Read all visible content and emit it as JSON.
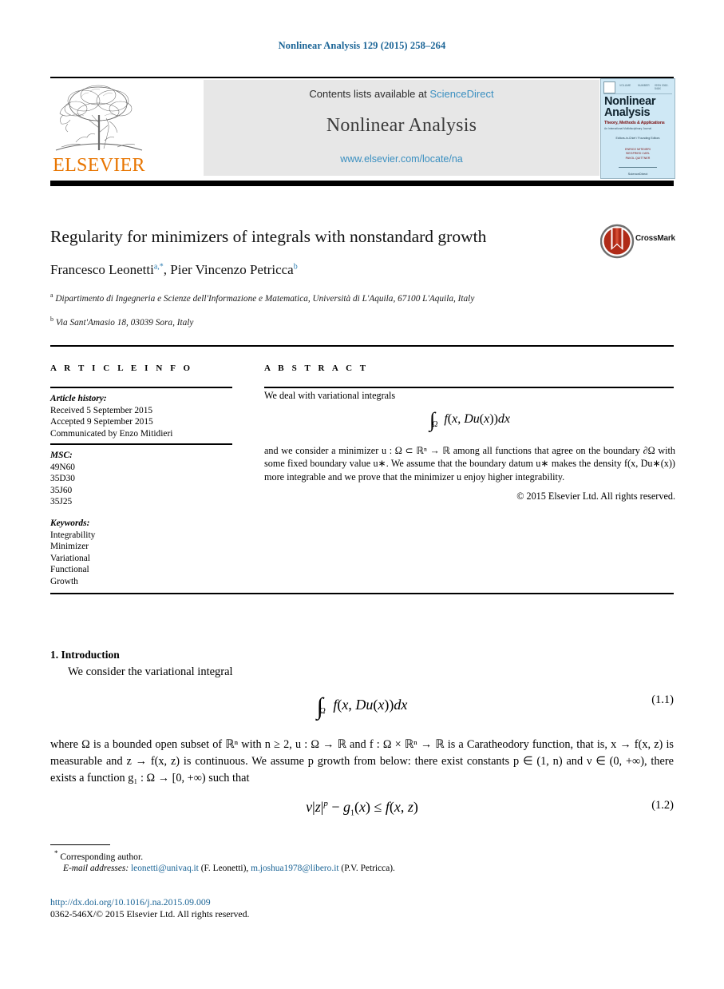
{
  "running_head": "Nonlinear Analysis 129 (2015) 258–264",
  "masthead": {
    "publisher": "ELSEVIER",
    "contents_prefix": "Contents lists available at ",
    "contents_link": "ScienceDirect",
    "journal_name": "Nonlinear Analysis",
    "journal_url": "www.elsevier.com/locate/na",
    "cover": {
      "title": "Nonlinear Analysis",
      "subtitle": "Theory, Methods & Applications",
      "subtitle2": "An International Multidisciplinary Journal",
      "editors_label": "Editors-in-Chief / Founding Editors",
      "editor_names": "ENRICO MITIDIERI\nSIEGFRIED CARL\nPAVOL QUITTNER",
      "footer": "ScienceDirect",
      "topbar_left": "VOLUME",
      "topbar_mid": "NUMBER",
      "topbar_right": "ISSN 0362-546X"
    }
  },
  "title": "Regularity for minimizers of integrals with nonstandard growth",
  "crossmark_label": "CrossMark",
  "authors": {
    "name1": "Francesco Leonetti",
    "sup1": "a,*",
    "separator": ", ",
    "name2": "Pier Vincenzo Petricca",
    "sup2": "b"
  },
  "affiliations": [
    {
      "marker": "a",
      "text": "Dipartimento di Ingegneria e Scienze dell'Informazione e Matematica, Università di L'Aquila, 67100 L'Aquila, Italy"
    },
    {
      "marker": "b",
      "text": "Via Sant'Amasio 18, 03039 Sora, Italy"
    }
  ],
  "article_info": {
    "heading": "A R T I C L E   I N F O",
    "history_label": "Article history:",
    "history": [
      "Received 5 September 2015",
      "Accepted 9 September 2015",
      "Communicated by Enzo Mitidieri"
    ],
    "msc_label": "MSC:",
    "msc": [
      "49N60",
      "35D30",
      "35J60",
      "35J25"
    ],
    "keywords_label": "Keywords:",
    "keywords": [
      "Integrability",
      "Minimizer",
      "Variational",
      "Functional",
      "Growth"
    ]
  },
  "abstract": {
    "heading": "A B S T R A C T",
    "lead": "We deal with variational integrals",
    "formula": "∫Ω f(x, Du(x))dx",
    "body": "and we consider a minimizer u : Ω ⊂ ℝⁿ → ℝ among all functions that agree on the boundary ∂Ω with some fixed boundary value u∗. We assume that the boundary datum u∗ makes the density f(x, Du∗(x)) more integrable and we prove that the minimizer u enjoy higher integrability.",
    "copyright": "© 2015 Elsevier Ltd. All rights reserved."
  },
  "introduction": {
    "heading": "1.  Introduction",
    "lead": "We consider the variational integral",
    "eq11": "∫Ω f(x, Du(x))dx",
    "eq11_num": "(1.1)",
    "paragraph": "where Ω is a bounded open subset of ℝⁿ with n ≥ 2, u : Ω → ℝ and f : Ω × ℝⁿ → ℝ is a Caratheodory function, that is, x → f(x, z) is measurable and z → f(x, z) is continuous. We assume p growth from below: there exist constants p ∈ (1, n) and ν ∈ (0, +∞), there exists a function g₁ : Ω → [0, +∞) such that",
    "eq12": "ν|z|ᵖ − g₁(x) ≤ f(x, z)",
    "eq12_num": "(1.2)"
  },
  "footnotes": {
    "corresponding": "Corresponding author.",
    "corresponding_marker": "*",
    "email_label": "E-mail addresses:",
    "email1": "leonetti@univaq.it",
    "email1_owner": "(F. Leonetti),",
    "email2": "m.joshua1978@libero.it",
    "email2_owner": "(P.V. Petricca).",
    "doi": "http://dx.doi.org/10.1016/j.na.2015.09.009",
    "issn": "0362-546X/© 2015 Elsevier Ltd. All rights reserved."
  },
  "colors": {
    "link": "#1a6496",
    "sciencedirect": "#3a8fc0",
    "elsevier_orange": "#E87500",
    "cover_blue": "#cfe8f5"
  }
}
